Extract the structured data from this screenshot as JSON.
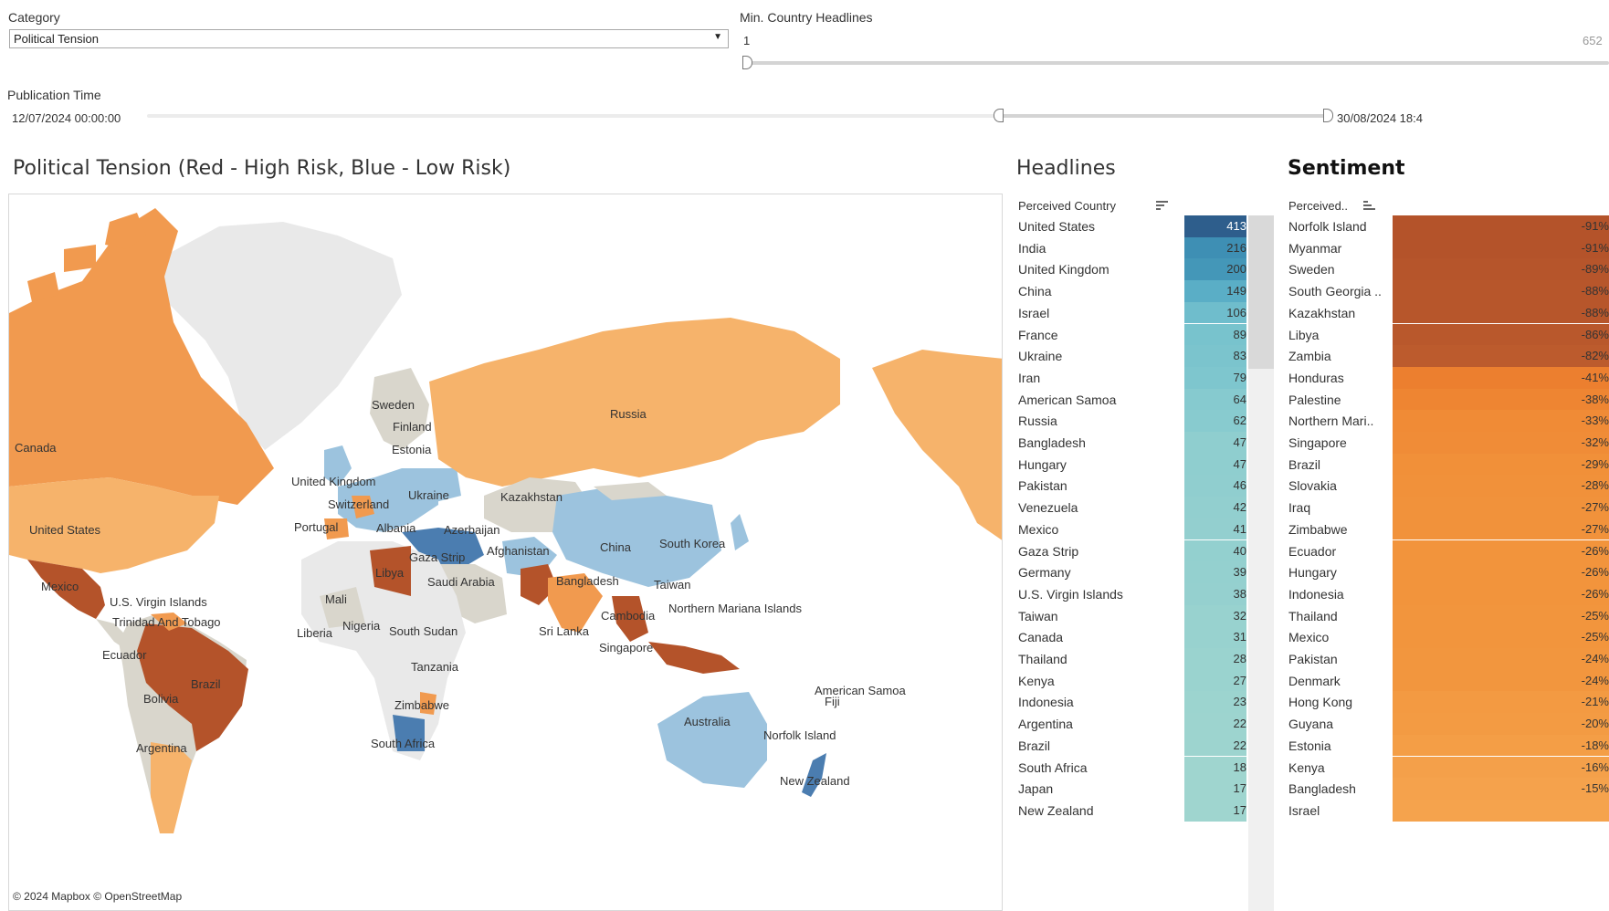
{
  "filters": {
    "category_label": "Category",
    "category_value": "Political Tension",
    "min_headlines_label": "Min. Country Headlines",
    "min_headlines_min": "1",
    "min_headlines_max": "652",
    "min_headlines_level": 0,
    "pub_time_label": "Publication Time",
    "pub_time_start": "12/07/2024 00:00:00",
    "pub_time_end": "30/08/2024 18:4"
  },
  "map": {
    "title": "Political Tension (Red - High Risk, Blue - Low Risk)",
    "credit": "© 2024 Mapbox  © OpenStreetMap",
    "labels": [
      "Canada",
      "United States",
      "Mexico",
      "U.S. Virgin Islands",
      "Trinidad And Tobago",
      "Ecuador",
      "Brazil",
      "Bolivia",
      "Argentina",
      "Sweden",
      "Finland",
      "Estonia",
      "United Kingdom",
      "Switzerland",
      "Portugal",
      "Albania",
      "Ukraine",
      "Azerbaijan",
      "Kazakhstan",
      "Russia",
      "Gaza Strip",
      "Afghanistan",
      "Libya",
      "Saudi Arabia",
      "Mali",
      "Nigeria",
      "Liberia",
      "South Sudan",
      "Tanzania",
      "Zimbabwe",
      "South Africa",
      "China",
      "South Korea",
      "Bangladesh",
      "Taiwan",
      "Northern Mariana Islands",
      "Sri Lanka",
      "Cambodia",
      "Singapore",
      "Australia",
      "American Samoa",
      "Fiji",
      "Norfolk Island",
      "New Zealand"
    ],
    "colors": {
      "high": "#b4532a",
      "mid": "#f19a4f",
      "low_orange": "#f6b36b",
      "neutral": "#d9d6cc",
      "blue": "#9cc3de",
      "deep_blue": "#4b7db0",
      "none": "#e9e9e9"
    }
  },
  "headlines": {
    "title": "Headlines",
    "column_header": "Perceived Country",
    "rows": [
      {
        "country": "United States",
        "value": "413",
        "color": "#2e5e8c"
      },
      {
        "country": "India",
        "value": "216",
        "color": "#3e8fb4"
      },
      {
        "country": "United Kingdom",
        "value": "200",
        "color": "#4497b8"
      },
      {
        "country": "China",
        "value": "149",
        "color": "#5aaec6"
      },
      {
        "country": "Israel",
        "value": "106",
        "color": "#6fbdcc"
      },
      {
        "country": "France",
        "value": "89",
        "color": "#78c3cd"
      },
      {
        "country": "Ukraine",
        "value": "83",
        "color": "#7bc4cd"
      },
      {
        "country": "Iran",
        "value": "79",
        "color": "#7ec6ce"
      },
      {
        "country": "American Samoa",
        "value": "64",
        "color": "#86cacf"
      },
      {
        "country": "Russia",
        "value": "62",
        "color": "#88cbcf"
      },
      {
        "country": "Bangladesh",
        "value": "47",
        "color": "#8fcecf"
      },
      {
        "country": "Hungary",
        "value": "47",
        "color": "#8fcecf"
      },
      {
        "country": "Pakistan",
        "value": "46",
        "color": "#90cecf"
      },
      {
        "country": "Venezuela",
        "value": "42",
        "color": "#92cfcf"
      },
      {
        "country": "Mexico",
        "value": "41",
        "color": "#93cfcf"
      },
      {
        "country": "Gaza Strip",
        "value": "40",
        "color": "#93d0cf"
      },
      {
        "country": "Germany",
        "value": "39",
        "color": "#94d0cf"
      },
      {
        "country": "U.S. Virgin Islands",
        "value": "38",
        "color": "#95d0cf"
      },
      {
        "country": "Taiwan",
        "value": "32",
        "color": "#98d2cf"
      },
      {
        "country": "Canada",
        "value": "31",
        "color": "#98d2cf"
      },
      {
        "country": "Thailand",
        "value": "28",
        "color": "#9ad3cf"
      },
      {
        "country": "Kenya",
        "value": "27",
        "color": "#9ad3cf"
      },
      {
        "country": "Indonesia",
        "value": "23",
        "color": "#9cd4cf"
      },
      {
        "country": "Argentina",
        "value": "22",
        "color": "#9dd4cf"
      },
      {
        "country": "Brazil",
        "value": "22",
        "color": "#9dd4cf"
      },
      {
        "country": "South Africa",
        "value": "18",
        "color": "#9fd5cf"
      },
      {
        "country": "Japan",
        "value": "17",
        "color": "#9fd5cf"
      },
      {
        "country": "New Zealand",
        "value": "17",
        "color": "#9fd5cf"
      }
    ]
  },
  "sentiment": {
    "title": "Sentiment",
    "column_header": "Perceived..",
    "rows": [
      {
        "country": "Norfolk Island",
        "value": "-91%",
        "color": "#b4532a"
      },
      {
        "country": "Myanmar",
        "value": "-91%",
        "color": "#b4532a"
      },
      {
        "country": "Sweden",
        "value": "-89%",
        "color": "#b6552b"
      },
      {
        "country": "South Georgia ..",
        "value": "-88%",
        "color": "#b7562b"
      },
      {
        "country": "Kazakhstan",
        "value": "-88%",
        "color": "#b7562b"
      },
      {
        "country": "Libya",
        "value": "-86%",
        "color": "#b9582c"
      },
      {
        "country": "Zambia",
        "value": "-82%",
        "color": "#bc5b2d"
      },
      {
        "country": "Honduras",
        "value": "-41%",
        "color": "#ec7f2f"
      },
      {
        "country": "Palestine",
        "value": "-38%",
        "color": "#ee8532"
      },
      {
        "country": "Northern Mari..",
        "value": "-33%",
        "color": "#f08b36"
      },
      {
        "country": "Singapore",
        "value": "-32%",
        "color": "#f08c37"
      },
      {
        "country": "Brazil",
        "value": "-29%",
        "color": "#f19039"
      },
      {
        "country": "Slovakia",
        "value": "-28%",
        "color": "#f1913a"
      },
      {
        "country": "Iraq",
        "value": "-27%",
        "color": "#f1923b"
      },
      {
        "country": "Zimbabwe",
        "value": "-27%",
        "color": "#f1923b"
      },
      {
        "country": "Ecuador",
        "value": "-26%",
        "color": "#f2943c"
      },
      {
        "country": "Hungary",
        "value": "-26%",
        "color": "#f2943c"
      },
      {
        "country": "Indonesia",
        "value": "-26%",
        "color": "#f2943c"
      },
      {
        "country": "Thailand",
        "value": "-25%",
        "color": "#f2953d"
      },
      {
        "country": "Mexico",
        "value": "-25%",
        "color": "#f2953d"
      },
      {
        "country": "Pakistan",
        "value": "-24%",
        "color": "#f2963e"
      },
      {
        "country": "Denmark",
        "value": "-24%",
        "color": "#f2963e"
      },
      {
        "country": "Hong Kong",
        "value": "-21%",
        "color": "#f39a42"
      },
      {
        "country": "Guyana",
        "value": "-20%",
        "color": "#f39b43"
      },
      {
        "country": "Estonia",
        "value": "-18%",
        "color": "#f49e46"
      },
      {
        "country": "Kenya",
        "value": "-16%",
        "color": "#f4a04a"
      },
      {
        "country": "Bangladesh",
        "value": "-15%",
        "color": "#f5a24c"
      },
      {
        "country": "Israel",
        "value": "",
        "color": "#f5a34d"
      }
    ]
  }
}
